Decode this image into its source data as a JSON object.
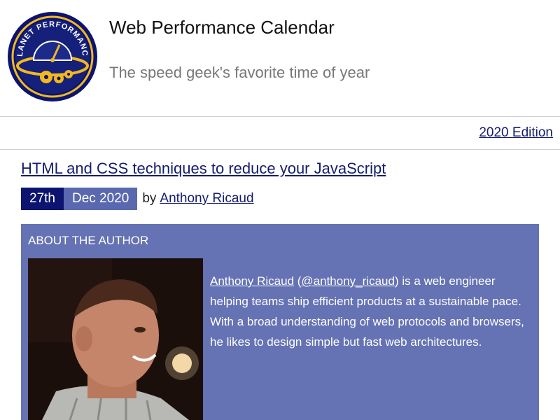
{
  "header": {
    "logo_text": "PLANET PERFORMANCE",
    "site_title": "Web Performance Calendar",
    "tagline": "The speed geek's favorite time of year"
  },
  "edition": {
    "label": "2020 Edition"
  },
  "article": {
    "title": "HTML and CSS techniques to reduce your JavaScript",
    "date_day": "27th",
    "date_month_year": "Dec 2020",
    "by_label": "by",
    "author_name": "Anthony Ricaud"
  },
  "author_box": {
    "heading": "ABOUT THE AUTHOR",
    "bio_name": "Anthony Ricaud",
    "bio_open_paren": " (",
    "bio_handle": "@anthony_ricaud",
    "bio_text": ") is a web engineer helping teams ship efficient products at a sustainable pace. With a broad understanding of web protocols and browsers, he likes to design simple but fast web architectures."
  },
  "colors": {
    "brand_navy": "#0c1470",
    "link_navy": "#141c6e",
    "author_box_bg": "#6572b3",
    "date_month_bg": "#5a68b0",
    "logo_gold": "#f2b81c",
    "tagline_gray": "#777777"
  }
}
